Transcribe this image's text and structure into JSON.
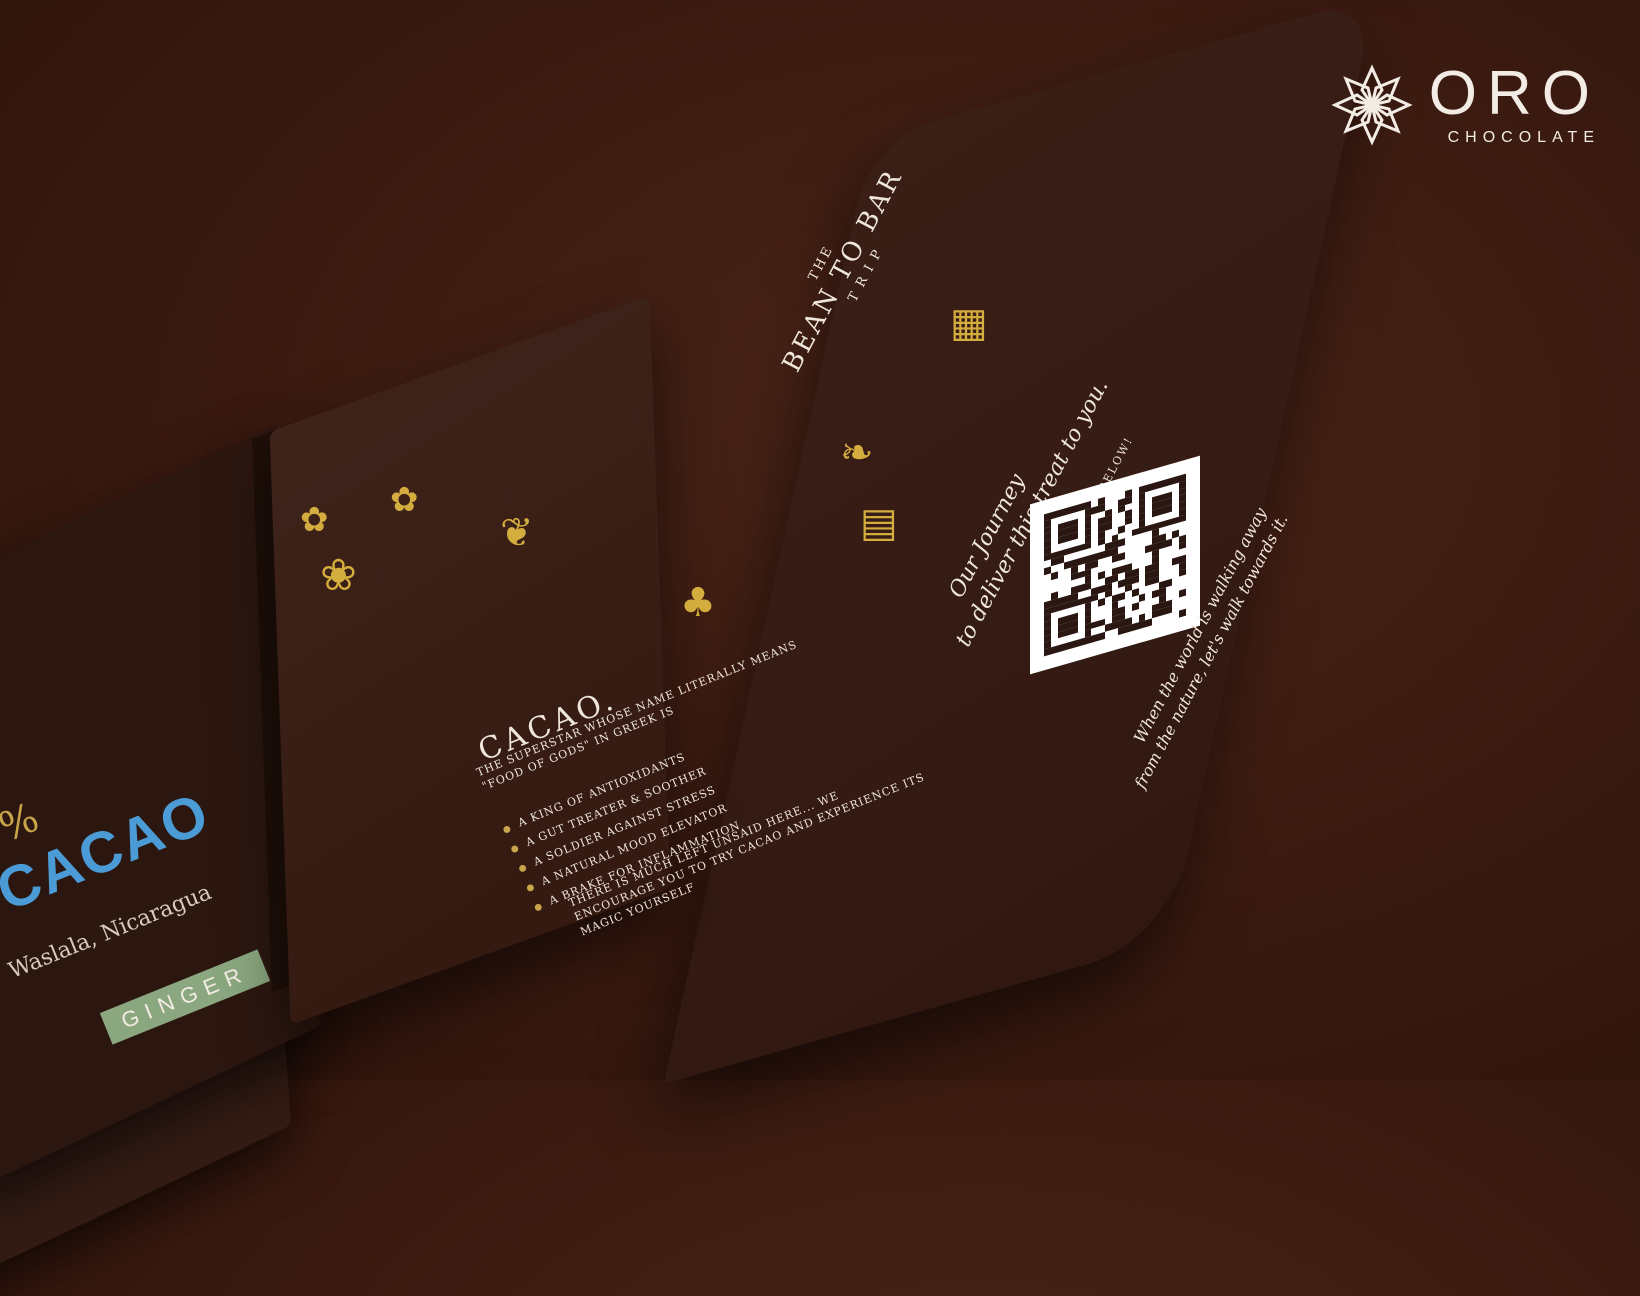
{
  "logo": {
    "word": "ORO",
    "sub": "CHOCOLATE"
  },
  "left_page": {
    "title": "CACAO.",
    "subtitle": "THE SUPERSTAR WHOSE NAME LITERALLY MEANS \"FOOD OF GODS\" IN GREEK IS",
    "bullets": [
      "A KING OF ANTIOXIDANTS",
      "A GUT TREATER & SOOTHER",
      "A SOLDIER AGAINST STRESS",
      "A NATURAL MOOD ELEVATOR",
      "A BRAKE FOR INFLAMMATION"
    ],
    "closing": "THERE IS MUCH LEFT UNSAID HERE... WE ENCOURAGE YOU TO TRY CACAO AND EXPERIENCE ITS MAGIC YOURSELF"
  },
  "right_page": {
    "title_line1": "THE",
    "title_line2": "BEAN TO BAR",
    "title_line3": "TRIP",
    "journey_line1": "Our Journey",
    "journey_line2": "to deliver this treat to you.",
    "scan": "SCAN THE CODE BELOW!",
    "walk_line1": "When the world is walking away",
    "walk_line2": "from the nature, let's walk towards it."
  },
  "bar": {
    "origin": "Waslala, Nicaragua",
    "flavor": "GINGER",
    "brand": "CACAO",
    "percent": "%"
  }
}
